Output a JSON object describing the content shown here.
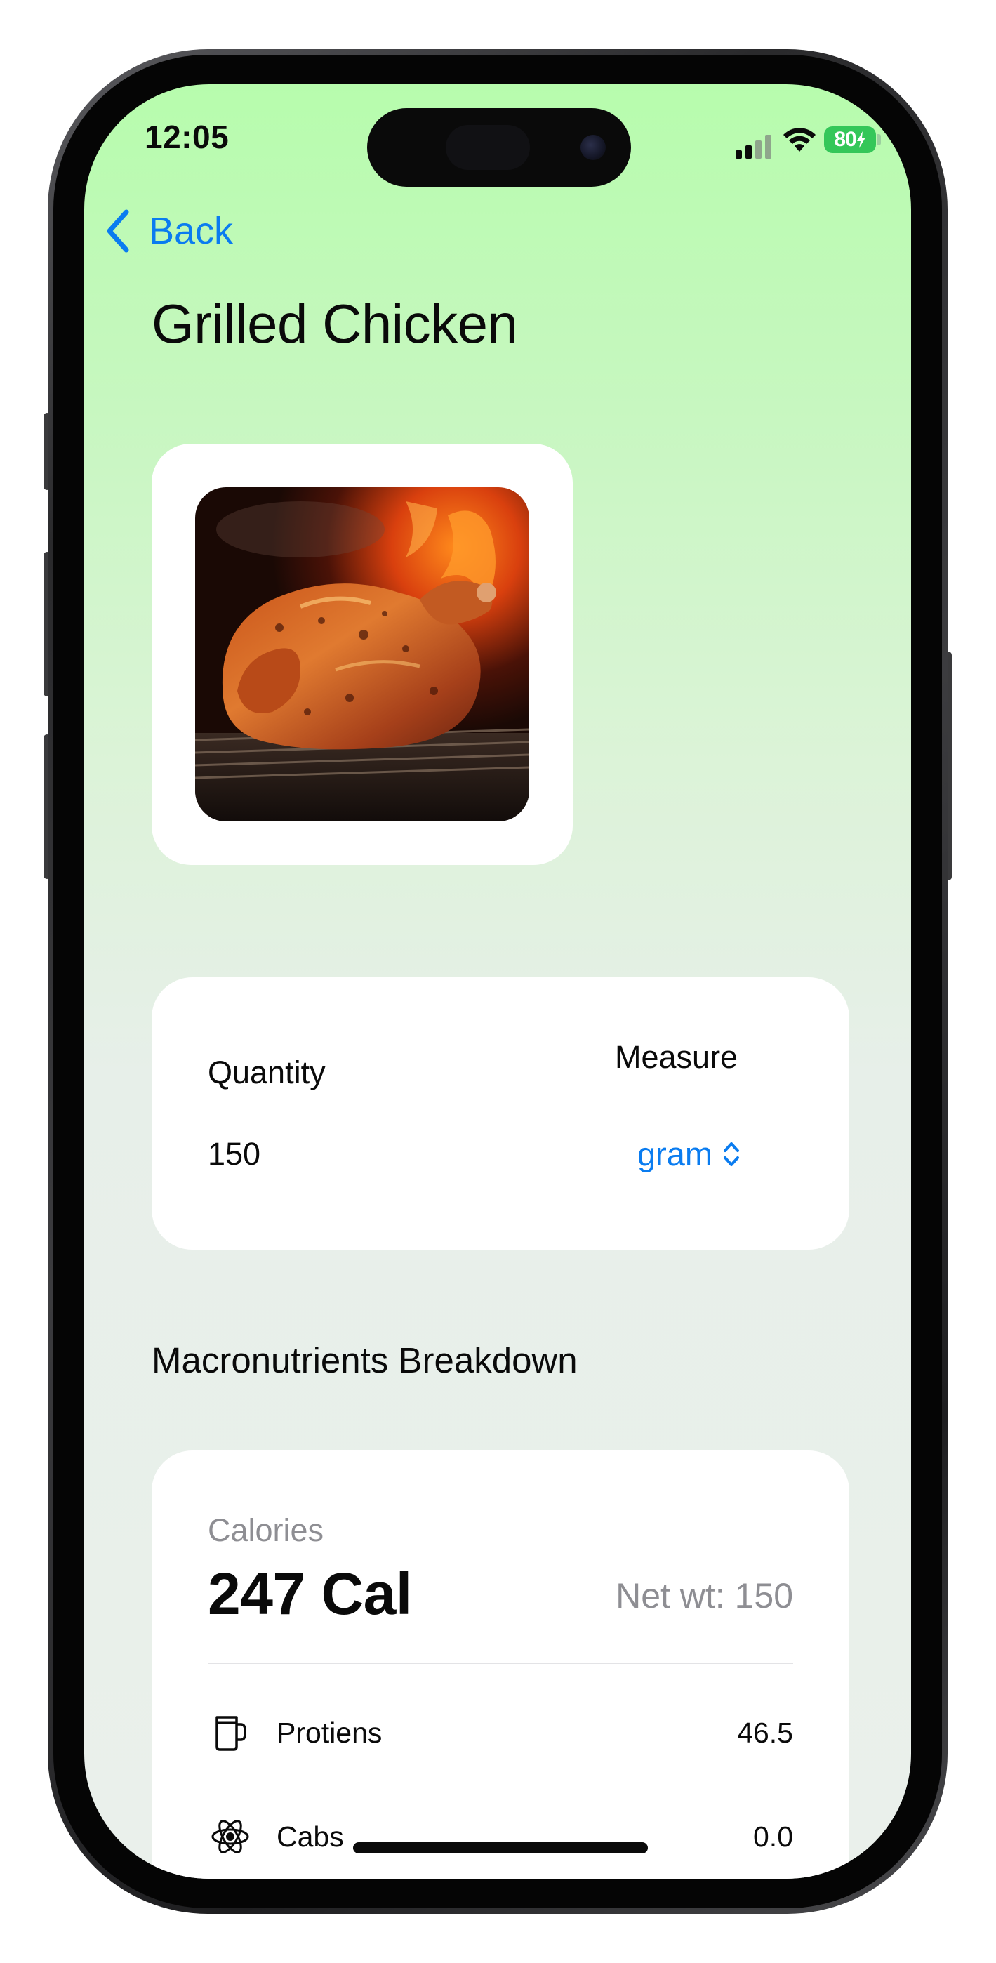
{
  "status_bar": {
    "time": "12:05",
    "battery": "80"
  },
  "nav": {
    "back_label": "Back"
  },
  "food": {
    "title": "Grilled Chicken",
    "image_icon": "grilled-chicken-photo"
  },
  "quantity_card": {
    "quantity_label": "Quantity",
    "quantity_value": "150",
    "measure_label": "Measure",
    "measure_value": "gram"
  },
  "macros": {
    "section_title": "Macronutrients Breakdown",
    "calories_caption": "Calories",
    "calories_value": "247 Cal",
    "net_weight": "Net wt: 150",
    "rows": [
      {
        "label": "Protiens",
        "value": "46.5",
        "icon": "cup-icon"
      },
      {
        "label": "Cabs",
        "value": "0.0",
        "icon": "atom-icon"
      }
    ]
  },
  "colors": {
    "accent": "#0a7cf0",
    "battery": "#34c759",
    "gradient_top": "#b7fcad",
    "gradient_bottom": "#eaf0eb",
    "secondary_text": "#8e8e93"
  }
}
